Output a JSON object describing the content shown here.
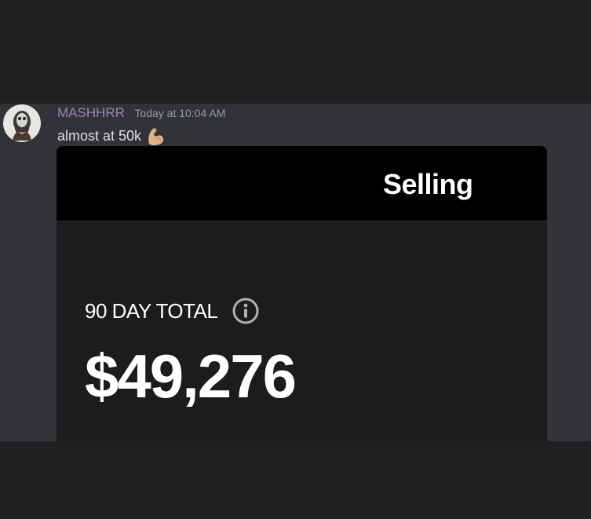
{
  "message": {
    "username": "MASHHRR",
    "timestamp": "Today at 10:04 AM",
    "text": "almost at 50k",
    "emoji": "flexed-biceps"
  },
  "attachment": {
    "title": "Selling",
    "period_label": "90 DAY TOTAL",
    "total_value": "$49,276"
  },
  "colors": {
    "username": "#a17fc4",
    "chat_background": "#313338",
    "attachment_header": "#000000",
    "attachment_body": "#1c1c1e"
  }
}
